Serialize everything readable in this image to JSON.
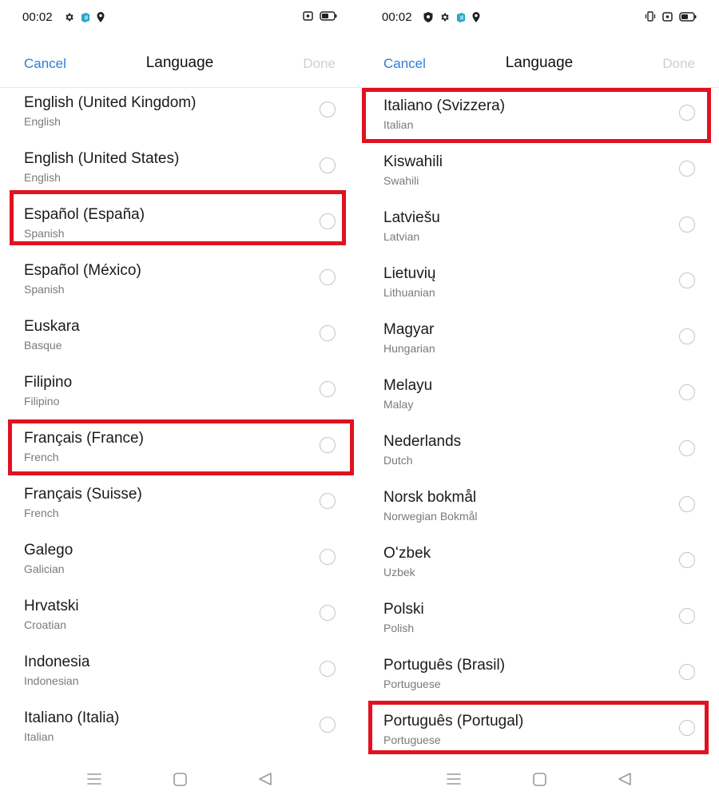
{
  "screens": [
    {
      "status": {
        "time": "00:02",
        "left_icons": [
          "gear-icon",
          "app-icon",
          "location-icon"
        ],
        "right_icons": [
          "screen-record-icon",
          "battery-icon"
        ]
      },
      "header": {
        "cancel_label": "Cancel",
        "title": "Language",
        "done_label": "Done"
      },
      "languages": [
        {
          "name": "English (United Kingdom)",
          "sub": "English",
          "highlighted": false
        },
        {
          "name": "English (United States)",
          "sub": "English",
          "highlighted": false
        },
        {
          "name": "Español (España)",
          "sub": "Spanish",
          "highlighted": true
        },
        {
          "name": "Español (México)",
          "sub": "Spanish",
          "highlighted": false
        },
        {
          "name": "Euskara",
          "sub": "Basque",
          "highlighted": false
        },
        {
          "name": "Filipino",
          "sub": "Filipino",
          "highlighted": false
        },
        {
          "name": "Français (France)",
          "sub": "French",
          "highlighted": true
        },
        {
          "name": "Français (Suisse)",
          "sub": "French",
          "highlighted": false
        },
        {
          "name": "Galego",
          "sub": "Galician",
          "highlighted": false
        },
        {
          "name": "Hrvatski",
          "sub": "Croatian",
          "highlighted": false
        },
        {
          "name": "Indonesia",
          "sub": "Indonesian",
          "highlighted": false
        },
        {
          "name": "Italiano (Italia)",
          "sub": "Italian",
          "highlighted": false
        }
      ],
      "nav": [
        "menu-icon",
        "home-icon",
        "back-icon"
      ]
    },
    {
      "status": {
        "time": "00:02",
        "left_icons": [
          "shield-icon",
          "gear-icon",
          "app-icon",
          "location-icon"
        ],
        "right_icons": [
          "vibrate-icon",
          "screen-record-icon",
          "battery-icon"
        ]
      },
      "header": {
        "cancel_label": "Cancel",
        "title": "Language",
        "done_label": "Done"
      },
      "languages": [
        {
          "name": "Italiano (Svizzera)",
          "sub": "Italian",
          "highlighted": true
        },
        {
          "name": "Kiswahili",
          "sub": "Swahili",
          "highlighted": false
        },
        {
          "name": "Latviešu",
          "sub": "Latvian",
          "highlighted": false
        },
        {
          "name": "Lietuvių",
          "sub": "Lithuanian",
          "highlighted": false
        },
        {
          "name": "Magyar",
          "sub": "Hungarian",
          "highlighted": false
        },
        {
          "name": "Melayu",
          "sub": "Malay",
          "highlighted": false
        },
        {
          "name": "Nederlands",
          "sub": "Dutch",
          "highlighted": false
        },
        {
          "name": "Norsk bokmål",
          "sub": "Norwegian Bokmål",
          "highlighted": false
        },
        {
          "name": "Oʻzbek",
          "sub": "Uzbek",
          "highlighted": false
        },
        {
          "name": "Polski",
          "sub": "Polish",
          "highlighted": false
        },
        {
          "name": "Português (Brasil)",
          "sub": "Portuguese",
          "highlighted": false
        },
        {
          "name": "Português (Portugal)",
          "sub": "Portuguese",
          "highlighted": true
        }
      ],
      "nav": [
        "menu-icon",
        "home-icon",
        "back-icon"
      ]
    }
  ],
  "colors": {
    "accent": "#2f7bd9",
    "done_disabled": "#cfcfcf",
    "highlight": "#e0121f",
    "subtext": "#7a7a7a",
    "radio_border": "#c4c4c4"
  }
}
